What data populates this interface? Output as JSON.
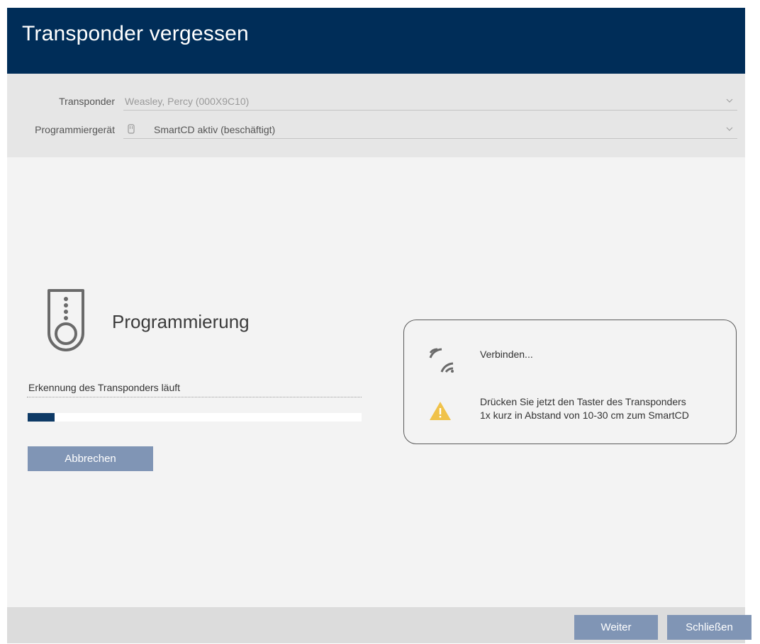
{
  "dialog": {
    "title": "Transponder vergessen"
  },
  "form": {
    "transponder": {
      "label": "Transponder",
      "value": "Weasley, Percy (000X9C10)"
    },
    "device": {
      "label": "Programmiergerät",
      "value": "SmartCD aktiv (beschäftigt)",
      "icon": "smartcd-device-icon"
    }
  },
  "programming": {
    "title": "Programmierung",
    "icon": "transponder-icon",
    "status": "Erkennung des Transponders läuft",
    "progress_percent": 8,
    "cancel_label": "Abbrechen"
  },
  "messages": {
    "connect": {
      "icon": "wireless-signal-icon",
      "text": "Verbinden..."
    },
    "hint": {
      "icon": "warning-icon",
      "line1": "Drücken Sie jetzt den Taster des Transponders",
      "line2": "1x kurz in Abstand von 10-30 cm zum SmartCD"
    }
  },
  "footer": {
    "next_label": "Weiter",
    "close_label": "Schließen"
  },
  "colors": {
    "header": "#002d58",
    "button": "#8095b5",
    "progress": "#0e3a66",
    "warning": "#f0c24a"
  }
}
